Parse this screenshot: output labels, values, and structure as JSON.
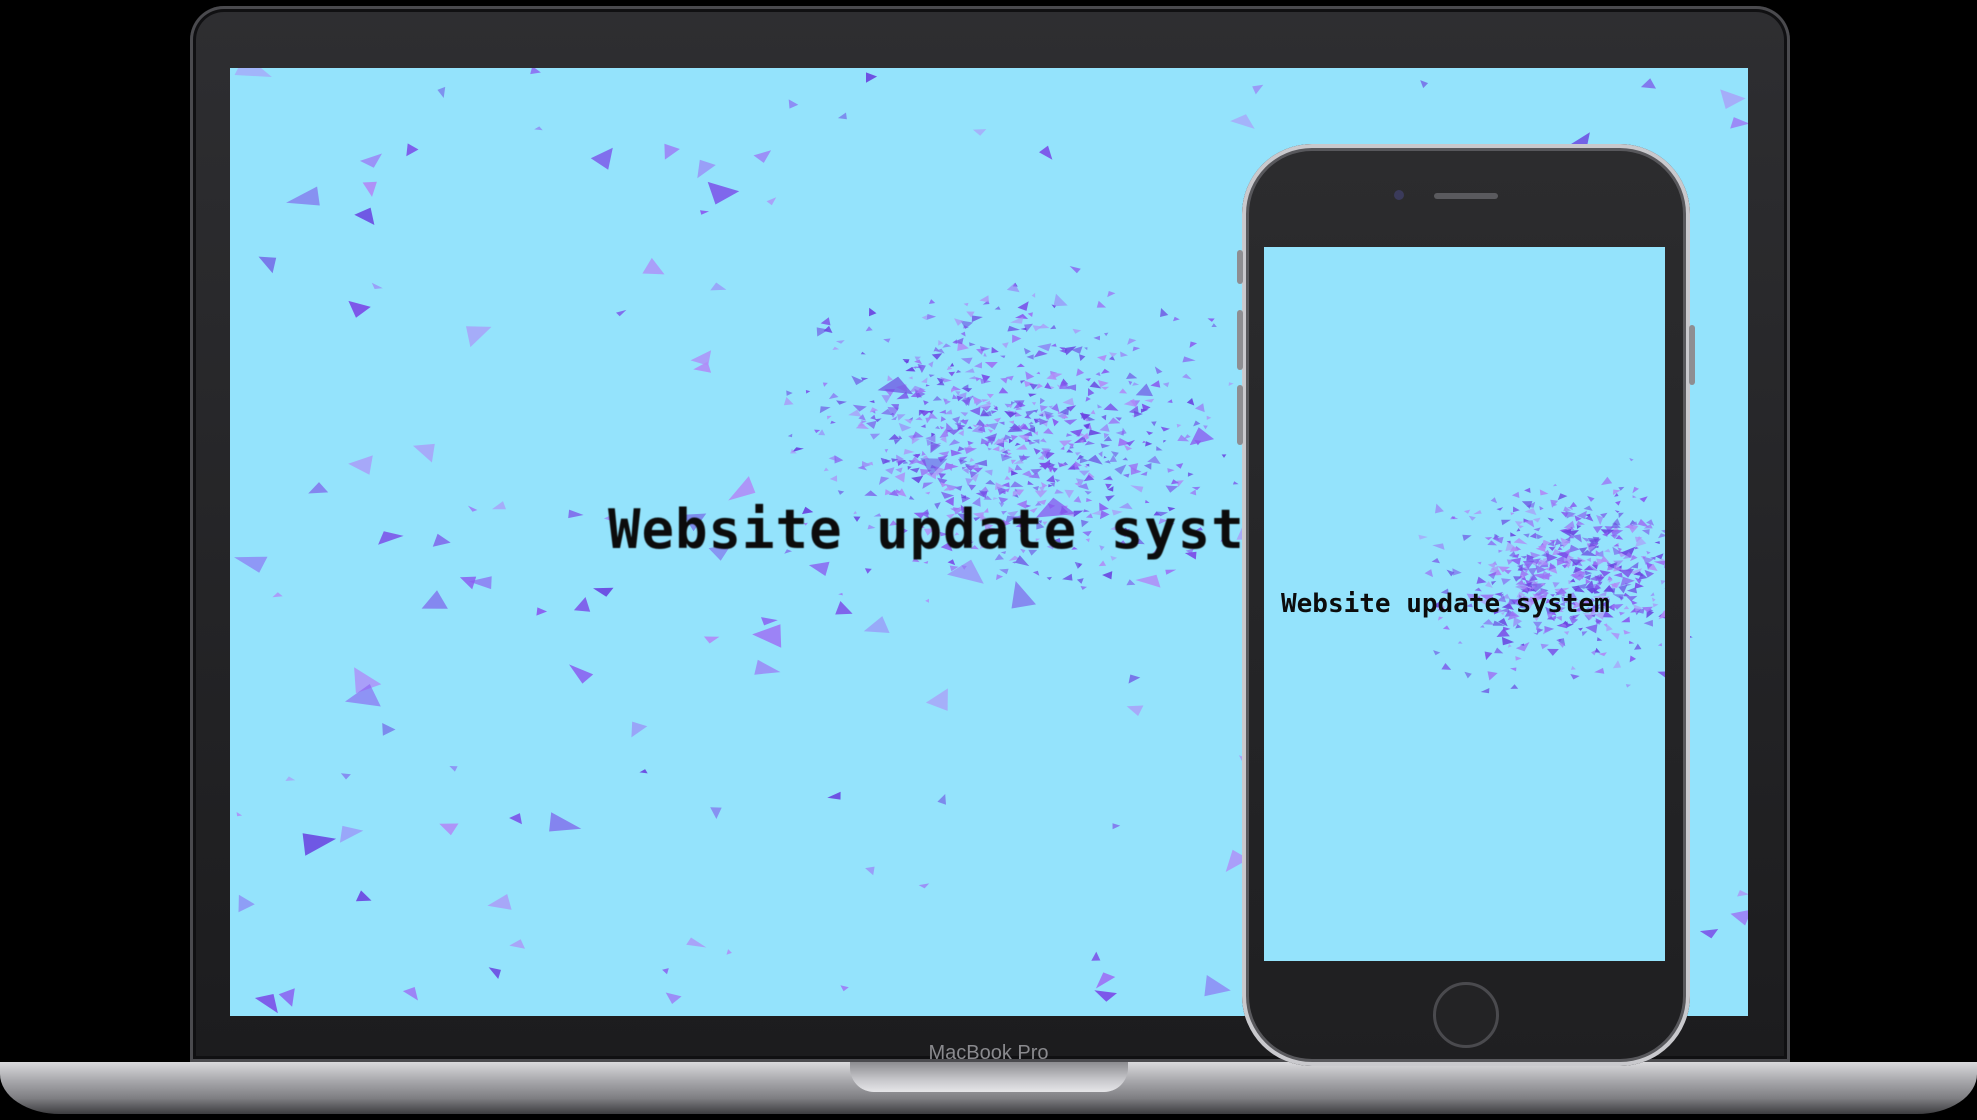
{
  "laptop": {
    "brand_label": "MacBook Pro",
    "screen": {
      "title": "Website update system",
      "background_color": "#94e3fc",
      "accent_color": "#8a5cf0"
    }
  },
  "phone": {
    "screen": {
      "title": "Website update system",
      "background_color": "#94e3fc",
      "accent_color": "#8a5cf0"
    }
  }
}
